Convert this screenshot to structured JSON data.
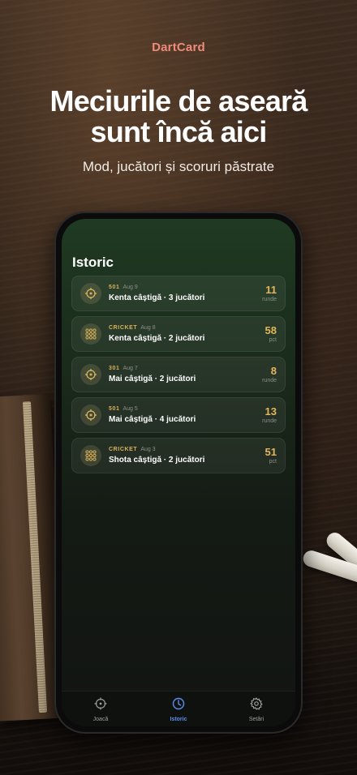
{
  "brand": "DartCard",
  "headline": {
    "line1": "Meciurile de aseară",
    "line2": "sunt încă aici"
  },
  "subtitle": "Mod, jucători și scoruri păstrate",
  "screen": {
    "title": "Istoric",
    "matches": [
      {
        "mode": "501",
        "date": "Aug 9",
        "title": "Kenta câștigă · 3 jucători",
        "score": "11",
        "unit": "runde",
        "icon": "target-icon"
      },
      {
        "mode": "CRICKET",
        "date": "Aug 8",
        "title": "Kenta câștigă · 2 jucători",
        "score": "58",
        "unit": "pct",
        "icon": "grid-dots-icon"
      },
      {
        "mode": "301",
        "date": "Aug 7",
        "title": "Mai câștigă · 2 jucători",
        "score": "8",
        "unit": "runde",
        "icon": "target-icon"
      },
      {
        "mode": "501",
        "date": "Aug 5",
        "title": "Mai câștigă · 4 jucători",
        "score": "13",
        "unit": "runde",
        "icon": "target-icon"
      },
      {
        "mode": "CRICKET",
        "date": "Aug 3",
        "title": "Shota câștigă · 2 jucători",
        "score": "51",
        "unit": "pct",
        "icon": "grid-dots-icon"
      }
    ]
  },
  "tabs": [
    {
      "label": "Joacă",
      "icon": "target-icon",
      "active": false
    },
    {
      "label": "Istoric",
      "icon": "clock-icon",
      "active": true
    },
    {
      "label": "Setări",
      "icon": "gear-icon",
      "active": false
    }
  ],
  "colors": {
    "brand": "#f08a7a",
    "accent_gold": "#e2b65c",
    "active_tab": "#5b8ff0"
  }
}
